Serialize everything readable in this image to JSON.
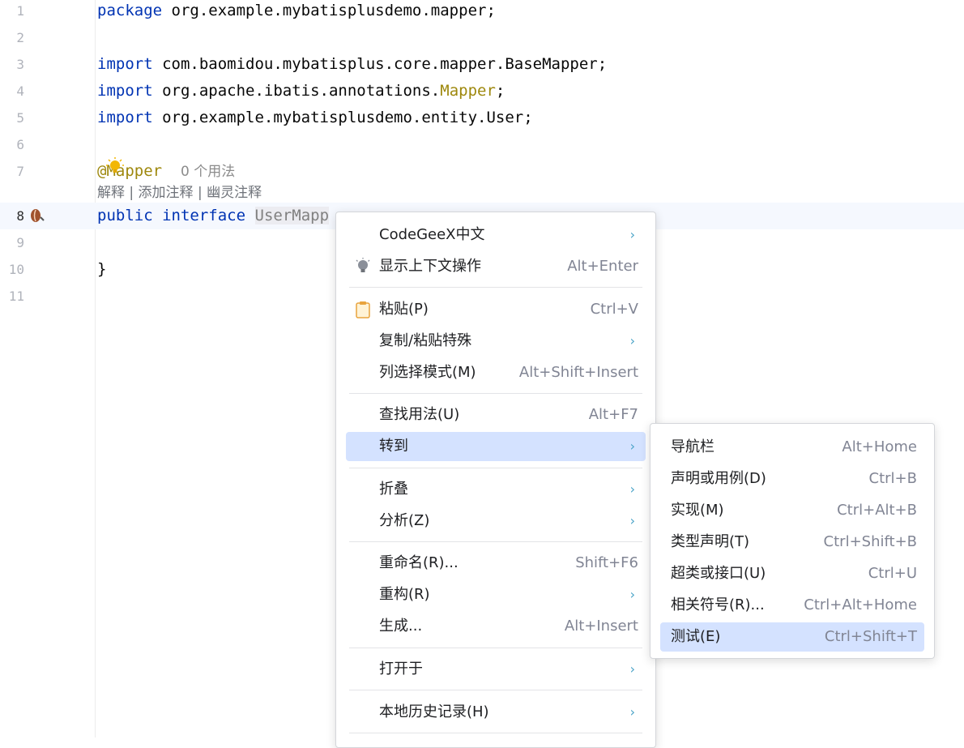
{
  "editor": {
    "lines": [
      {
        "n": "1"
      },
      {
        "n": "2"
      },
      {
        "n": "3"
      },
      {
        "n": "4"
      },
      {
        "n": "5"
      },
      {
        "n": "6"
      },
      {
        "n": "7"
      },
      {
        "n": "8"
      },
      {
        "n": "9"
      },
      {
        "n": "10"
      },
      {
        "n": "11"
      }
    ],
    "code": {
      "l1_kw": "package",
      "l1_rest": " org.example.mybatisplusdemo.mapper;",
      "l3_kw": "import",
      "l3_rest": " com.baomidou.mybatisplus.core.mapper.BaseMapper;",
      "l4_kw": "import",
      "l4_a": " org.apache.ibatis.annotations.",
      "l4_ann": "Mapper",
      "l4_end": ";",
      "l5_kw": "import",
      "l5_rest": " org.example.mybatisplusdemo.entity.User;",
      "l7_ann": "@Mapper",
      "l7_hint": "0 个用法",
      "inlay": "解释 | 添加注释 | 幽灵注释",
      "l8_kw1": "public",
      "l8_kw2": "interface",
      "l8_name": "UserMapp",
      "l10": "}"
    }
  },
  "context_menu": {
    "items": [
      {
        "label": "CodeGeeX中文",
        "shortcut": "",
        "submenu": "›"
      },
      {
        "label": "显示上下文操作",
        "shortcut": "Alt+Enter",
        "icon": "lightbulb-icon"
      },
      {
        "label": "粘贴(P)",
        "shortcut": "Ctrl+V",
        "icon": "clipboard-icon"
      },
      {
        "label": "复制/粘贴特殊",
        "shortcut": "",
        "submenu": "›"
      },
      {
        "label": "列选择模式(M)",
        "shortcut": "Alt+Shift+Insert"
      },
      {
        "label": "查找用法(U)",
        "shortcut": "Alt+F7"
      },
      {
        "label": "转到",
        "shortcut": "",
        "submenu": "›"
      },
      {
        "label": "折叠",
        "shortcut": "",
        "submenu": "›"
      },
      {
        "label": "分析(Z)",
        "shortcut": "",
        "submenu": "›"
      },
      {
        "label": "重命名(R)...",
        "shortcut": "Shift+F6"
      },
      {
        "label": "重构(R)",
        "shortcut": "",
        "submenu": "›"
      },
      {
        "label": "生成...",
        "shortcut": "Alt+Insert"
      },
      {
        "label": "打开于",
        "shortcut": "",
        "submenu": "›"
      },
      {
        "label": "本地历史记录(H)",
        "shortcut": "",
        "submenu": "›"
      }
    ]
  },
  "goto_submenu": {
    "items": [
      {
        "label": "导航栏",
        "shortcut": "Alt+Home"
      },
      {
        "label": "声明或用例(D)",
        "shortcut": "Ctrl+B"
      },
      {
        "label": "实现(M)",
        "shortcut": "Ctrl+Alt+B"
      },
      {
        "label": "类型声明(T)",
        "shortcut": "Ctrl+Shift+B"
      },
      {
        "label": "超类或接口(U)",
        "shortcut": "Ctrl+U"
      },
      {
        "label": "相关符号(R)...",
        "shortcut": "Ctrl+Alt+Home"
      },
      {
        "label": "测试(E)",
        "shortcut": "Ctrl+Shift+T"
      }
    ]
  },
  "colors": {
    "selection": "#d4e2ff",
    "keyword": "#0033b3",
    "annotation": "#9e880d"
  }
}
